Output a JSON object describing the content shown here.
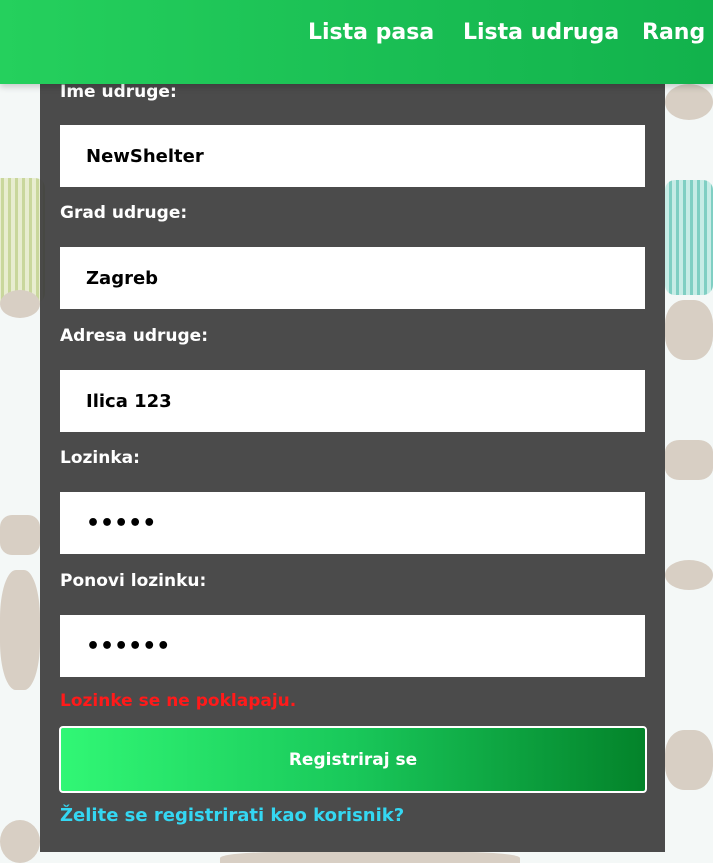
{
  "nav": {
    "items": [
      {
        "label": "Lista pasa"
      },
      {
        "label": "Lista udruga"
      },
      {
        "label": "Rang li"
      }
    ]
  },
  "form": {
    "fields": [
      {
        "label": "Ime udruge:",
        "value": "NewShelter"
      },
      {
        "label": "Grad udruge:",
        "value": "Zagreb"
      },
      {
        "label": "Adresa udruge:",
        "value": "Ilica 123"
      },
      {
        "label": "Lozinka:",
        "value": "•••••"
      },
      {
        "label": "Ponovi lozinku:",
        "value": "••••••"
      }
    ],
    "error": "Lozinke se ne poklapaju.",
    "submit_label": "Registriraj se",
    "alt_link": "Želite se registrirati kao korisnik?"
  },
  "colors": {
    "nav_green": "#19bd53",
    "panel": "#3c3c3c",
    "error": "#ff1a1a",
    "link": "#34d7f2"
  }
}
